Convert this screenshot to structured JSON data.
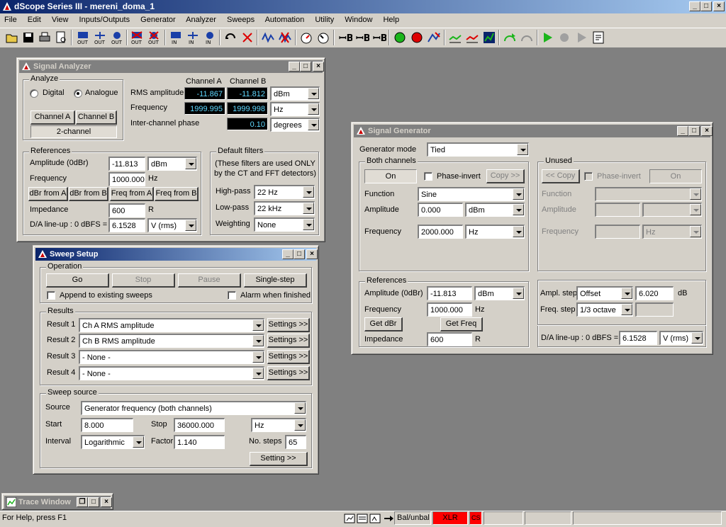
{
  "app": {
    "title": "dScope Series III - mereni_doma_1",
    "menu": [
      "File",
      "Edit",
      "View",
      "Inputs/Outputs",
      "Generator",
      "Analyzer",
      "Sweeps",
      "Automation",
      "Utility",
      "Window",
      "Help"
    ],
    "controls": {
      "min": "_",
      "max": "□",
      "close": "×"
    }
  },
  "toolbar": {
    "out_label": "OUT",
    "in_label": "IN"
  },
  "analyzer": {
    "title": "Signal Analyzer",
    "analyze_group": "Analyze",
    "digital": "Digital",
    "analogue": "Analogue",
    "channel_a_btn": "Channel A",
    "channel_b_btn": "Channel B",
    "two_channel": "2-channel",
    "col_a": "Channel A",
    "col_b": "Channel B",
    "rms_label": "RMS amplitude",
    "rms_a": "-11.867",
    "rms_b": "-11.812",
    "rms_unit": "dBm",
    "freq_label": "Frequency",
    "freq_a": "1999.995",
    "freq_b": "1999.998",
    "freq_unit": "Hz",
    "phase_label": "Inter-channel phase",
    "phase_val": "0.10",
    "phase_unit": "degrees",
    "refs_group": "References",
    "ampl_label": "Amplitude (0dBr)",
    "ampl_val": "-11.813",
    "ampl_unit": "dBm",
    "rfreq_label": "Frequency",
    "rfreq_val": "1000.000",
    "rfreq_unit": "Hz",
    "dbr_a": "dBr from A",
    "dbr_b": "dBr from B",
    "freq_from_a": "Freq from A",
    "freq_from_b": "Freq from B",
    "imp_label": "Impedance",
    "imp_val": "600",
    "imp_unit": "R",
    "da_label": "D/A line-up : 0 dBFS =",
    "da_val": "6.1528",
    "da_unit": "V (rms)",
    "filters_group": "Default filters",
    "filters_note": "(These filters are used ONLY by the CT and FFT detectors)",
    "hp_label": "High-pass",
    "hp_val": "22 Hz",
    "lp_label": "Low-pass",
    "lp_val": "22 kHz",
    "wt_label": "Weighting",
    "wt_val": "None"
  },
  "sweep": {
    "title": "Sweep Setup",
    "op_group": "Operation",
    "go": "Go",
    "stop": "Stop",
    "pause": "Pause",
    "single": "Single-step",
    "append": "Append to existing sweeps",
    "alarm": "Alarm when finished",
    "results_group": "Results",
    "results": [
      {
        "label": "Result 1",
        "value": "Ch A RMS amplitude"
      },
      {
        "label": "Result 2",
        "value": "Ch B RMS amplitude"
      },
      {
        "label": "Result 3",
        "value": "- None -"
      },
      {
        "label": "Result 4",
        "value": "- None -"
      }
    ],
    "settings_btn": "Settings >>",
    "source_group": "Sweep source",
    "source_label": "Source",
    "source_val": "Generator frequency (both channels)",
    "start_label": "Start",
    "start_val": "8.000",
    "stop_label": "Stop",
    "stop_val": "36000.000",
    "unit_val": "Hz",
    "interval_label": "Interval",
    "interval_val": "Logarithmic",
    "factor_label": "Factor",
    "factor_val": "1.140",
    "steps_label": "No. steps",
    "steps_val": "65",
    "setting_btn": "Setting >>"
  },
  "generator": {
    "title": "Signal Generator",
    "mode_label": "Generator mode",
    "mode_val": "Tied",
    "both_group": "Both channels",
    "on": "On",
    "phase_inv": "Phase-invert",
    "copy_fwd": "Copy >>",
    "func_label": "Function",
    "func_val": "Sine",
    "amp_label": "Amplitude",
    "amp_val": "0.000",
    "amp_unit": "dBm",
    "freq_label": "Frequency",
    "freq_val": "2000.000",
    "freq_unit": "Hz",
    "unused_group": "Unused",
    "copy_back": "<< Copy",
    "refs_group": "References",
    "ref_amp_label": "Amplitude (0dBr)",
    "ref_amp_val": "-11.813",
    "ref_amp_unit": "dBm",
    "ref_freq_label": "Frequency",
    "ref_freq_val": "1000.000",
    "ref_freq_unit": "Hz",
    "get_dbr": "Get dBr",
    "get_freq": "Get Freq",
    "imp_label": "Impedance",
    "imp_val": "600",
    "imp_unit": "R",
    "ampl_step_label": "Ampl. step",
    "ampl_step_mode": "Offset",
    "ampl_step_val": "6.020",
    "ampl_step_unit": "dB",
    "freq_step_label": "Freq. step",
    "freq_step_val": "1/3 octave",
    "da_label": "D/A line-up : 0 dBFS =",
    "da_val": "6.1528",
    "da_unit": "V (rms)"
  },
  "trace": {
    "title": "Trace Window"
  },
  "status": {
    "help": "For Help, press F1",
    "bal": "Bal/unbal",
    "xlr": "XLR",
    "badge": "CS"
  },
  "colors": {
    "title_active_start": "#0a246a",
    "title_active_end": "#a6caf0",
    "lcd_text": "#5fd8ff",
    "status_red": "#ff0000"
  }
}
